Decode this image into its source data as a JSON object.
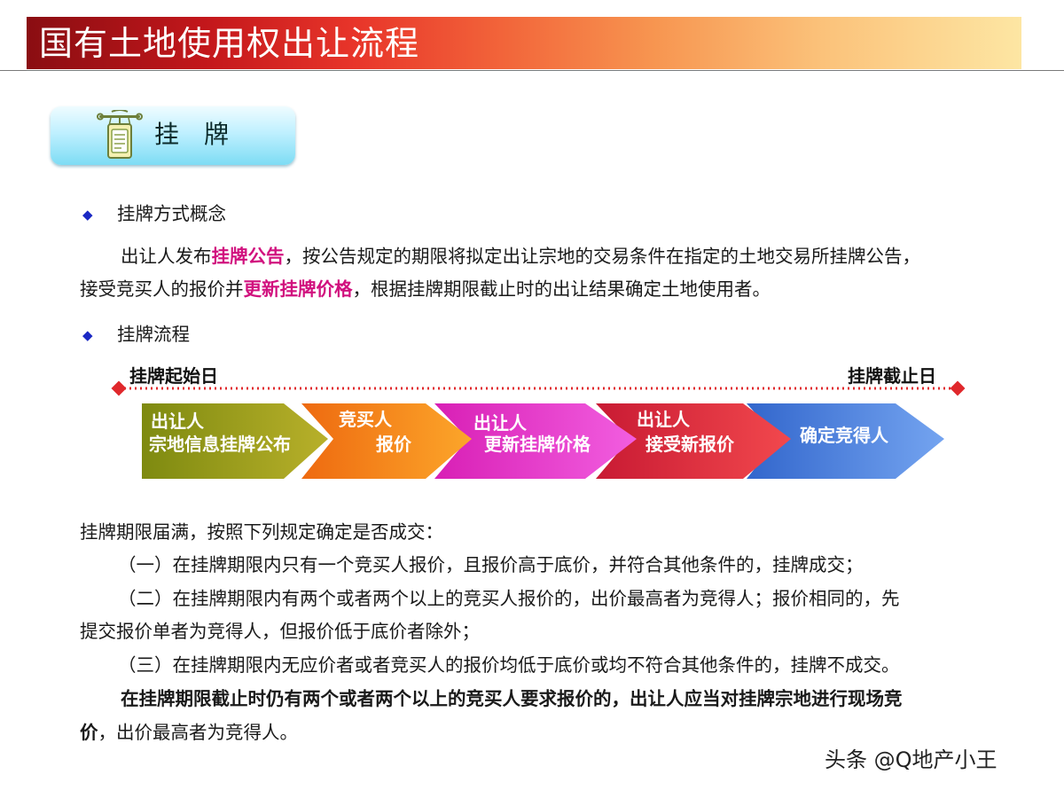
{
  "title": "国有土地使用权出让流程",
  "section": {
    "label": "挂　牌",
    "icon": "signboard-icon"
  },
  "concept": {
    "heading": "挂牌方式概念",
    "line1_pre": "出让人发布",
    "line1_hl": "挂牌公告",
    "line1_post": "，按公告规定的期限将拟定出让宗地的交易条件在指定的土地交易所挂牌公告，",
    "line2_pre": "接受竞买人的报价并",
    "line2_hl": "更新挂牌价格",
    "line2_post": "，根据挂牌期限截止时的出让结果确定土地使用者。"
  },
  "process": {
    "heading": "挂牌流程",
    "start_label": "挂牌起始日",
    "end_label": "挂牌截止日",
    "steps": [
      {
        "line1": "出让人",
        "line2": "宗地信息挂牌公布"
      },
      {
        "line1": "竞买人",
        "line2": "报价"
      },
      {
        "line1": "出让人",
        "line2": "更新挂牌价格"
      },
      {
        "line1": "出让人",
        "line2": "接受新报价"
      },
      {
        "line1": "确定竞得人",
        "line2": ""
      }
    ]
  },
  "rules": {
    "intro": "挂牌期限届满，按照下列规定确定是否成交：",
    "r1": "（一）在挂牌期限内只有一个竞买人报价，且报价高于底价，并符合其他条件的，挂牌成交；",
    "r2_a": "（二）在挂牌期限内有两个或者两个以上的竞买人报价的，出价最高者为竞得人；报价相同的，先",
    "r2_b": "提交报价单者为竞得人，但报价低于底价者除外；",
    "r3": "（三）在挂牌期限内无应价者或者竞买人的报价均低于底价或均不符合其他条件的，挂牌不成交。",
    "final_bold_a": "在挂牌期限截止时仍有两个或者两个以上的竞买人要求报价的，出让人应当对挂牌宗地进行现场竞",
    "final_bold_b": "价",
    "final_b_rest": "，出价最高者为竞得人。"
  },
  "watermark": "头条 @Q地产小王",
  "colors": {
    "accent_magenta": "#d1117e",
    "bullet_blue": "#1a28c4",
    "step1": "#a6a21a",
    "step2": "#f48a12",
    "step3": "#e53ad0",
    "step4": "#e8333f",
    "step5": "#4a82e0"
  }
}
